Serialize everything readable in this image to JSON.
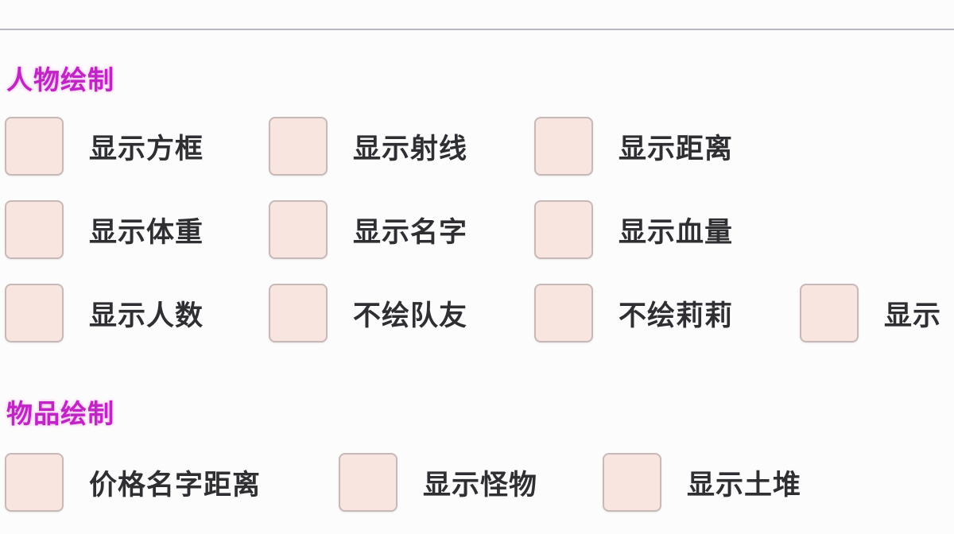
{
  "sections": [
    {
      "title": "人物绘制",
      "rows": [
        [
          {
            "label": "显示方框",
            "checked": false
          },
          {
            "label": "显示射线",
            "checked": false
          },
          {
            "label": "显示距离",
            "checked": false
          }
        ],
        [
          {
            "label": "显示体重",
            "checked": false
          },
          {
            "label": "显示名字",
            "checked": false
          },
          {
            "label": "显示血量",
            "checked": false
          }
        ],
        [
          {
            "label": "显示人数",
            "checked": false
          },
          {
            "label": "不绘队友",
            "checked": false
          },
          {
            "label": "不绘莉莉",
            "checked": false
          },
          {
            "label": "显示",
            "checked": false
          }
        ]
      ]
    },
    {
      "title": "物品绘制",
      "rows": [
        [
          {
            "label": "价格名字距离",
            "checked": false
          },
          {
            "label": "显示怪物",
            "checked": false
          },
          {
            "label": "显示土堆",
            "checked": false
          }
        ]
      ]
    }
  ],
  "colors": {
    "section_title": "#c024c4",
    "checkbox_fill": "#f8e5df",
    "checkbox_border": "#c7b9b8",
    "label_text": "#2f2f33",
    "divider": "#b9b6c2"
  }
}
